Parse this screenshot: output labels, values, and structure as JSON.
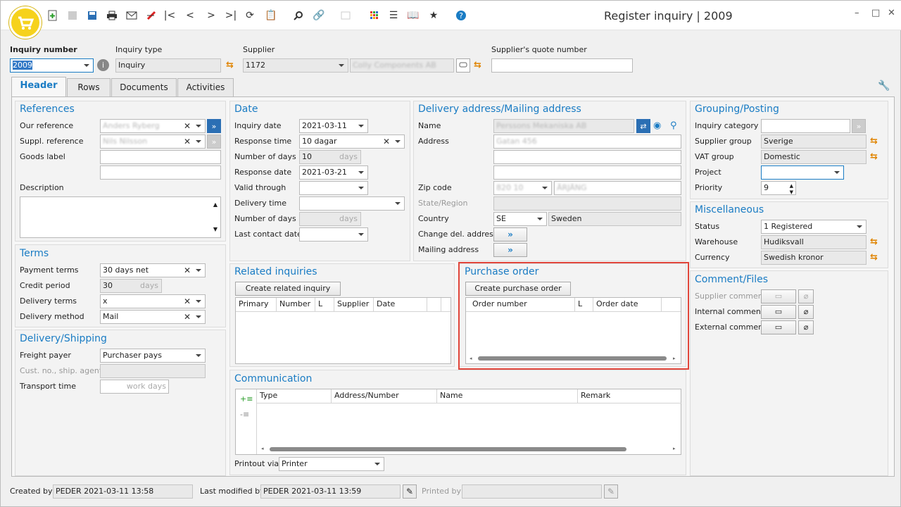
{
  "window": {
    "title": "Register inquiry | 2009",
    "minimize": "–",
    "maximize": "□",
    "close": "✕"
  },
  "header_fields": {
    "inquiry_number_label": "Inquiry number",
    "inquiry_number": "2009",
    "inquiry_type_label": "Inquiry type",
    "inquiry_type": "Inquiry",
    "supplier_label": "Supplier",
    "supplier_code": "1172",
    "supplier_name": "Colly Components AB",
    "supplier_quote_label": "Supplier's quote number",
    "supplier_quote": ""
  },
  "tabs": [
    "Header",
    "Rows",
    "Documents",
    "Activities"
  ],
  "references": {
    "title": "References",
    "our_reference_label": "Our reference",
    "our_reference": "Anders Ryberg",
    "suppl_reference_label": "Suppl. reference",
    "suppl_reference": "Nils Nilsson",
    "goods_label_label": "Goods label",
    "description_label": "Description"
  },
  "terms": {
    "title": "Terms",
    "payment_terms_label": "Payment terms",
    "payment_terms": "30 days net",
    "credit_period_label": "Credit period",
    "credit_period": "30",
    "days": "days",
    "delivery_terms_label": "Delivery terms",
    "delivery_terms": "x",
    "delivery_method_label": "Delivery method",
    "delivery_method": "Mail"
  },
  "shipping": {
    "title": "Delivery/Shipping",
    "freight_payer_label": "Freight payer",
    "freight_payer": "Purchaser pays",
    "cust_no_label": "Cust. no., ship. agent",
    "transport_time_label": "Transport time",
    "work_days": "work days"
  },
  "date": {
    "title": "Date",
    "inquiry_date_label": "Inquiry date",
    "inquiry_date": "2021-03-11",
    "response_time_label": "Response time",
    "response_time": "10 dagar",
    "number_of_days_label": "Number of days",
    "number_of_days": "10",
    "days": "days",
    "response_date_label": "Response date",
    "response_date": "2021-03-21",
    "valid_through_label": "Valid through",
    "delivery_time_label": "Delivery time",
    "number_of_days2_label": "Number of days",
    "last_contact_label": "Last contact date"
  },
  "delivery_address": {
    "title": "Delivery address/Mailing address",
    "name_label": "Name",
    "name": "Perssons Mekaniska AB",
    "address_label": "Address",
    "address": "Gatan 456",
    "zip_label": "Zip code",
    "zip": "820 10",
    "city": "ÄRJÄNG",
    "state_label": "State/Region",
    "country_label": "Country",
    "country_code": "SE",
    "country_name": "Sweden",
    "change_del_label": "Change del. address",
    "mailing_label": "Mailing address"
  },
  "grouping": {
    "title": "Grouping/Posting",
    "inquiry_category_label": "Inquiry category",
    "supplier_group_label": "Supplier group",
    "supplier_group": "Sverige",
    "vat_group_label": "VAT group",
    "vat_group": "Domestic",
    "project_label": "Project",
    "priority_label": "Priority",
    "priority": "9"
  },
  "misc": {
    "title": "Miscellaneous",
    "status_label": "Status",
    "status": "1 Registered",
    "warehouse_label": "Warehouse",
    "warehouse": "Hudiksvall",
    "currency_label": "Currency",
    "currency": "Swedish kronor"
  },
  "comments": {
    "title": "Comment/Files",
    "supplier_comment": "Supplier comment",
    "internal_comment": "Internal comment",
    "external_comment": "External comment"
  },
  "related": {
    "title": "Related inquiries",
    "create_button": "Create related inquiry",
    "columns": [
      "Primary",
      "Number",
      "L",
      "Supplier",
      "Date"
    ]
  },
  "purchase_order": {
    "title": "Purchase order",
    "create_button": "Create purchase order",
    "columns": [
      "Order number",
      "L",
      "Order date"
    ]
  },
  "communication": {
    "title": "Communication",
    "columns": [
      "Type",
      "Address/Number",
      "Name",
      "Remark"
    ],
    "printout_label": "Printout via",
    "printout": "Printer"
  },
  "statusbar": {
    "created_by_label": "Created by",
    "created_by": "PEDER 2021-03-11 13:58",
    "last_modified_label": "Last modified by",
    "last_modified": "PEDER 2021-03-11 13:59",
    "printed_by_label": "Printed by"
  }
}
